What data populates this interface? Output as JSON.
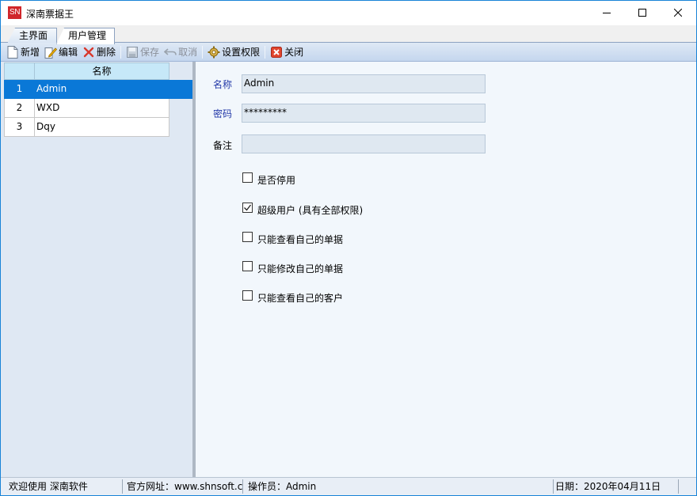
{
  "window": {
    "logo_text": "SN",
    "title": "深南票据王",
    "brand_color": "#d0262b"
  },
  "tabs": {
    "main": "主界面",
    "users": "用户管理"
  },
  "toolbar": {
    "add": "新增",
    "edit": "编辑",
    "delete": "删除",
    "save": "保存",
    "cancel": "取消",
    "permissions": "设置权限",
    "close": "关闭"
  },
  "grid": {
    "header_name": "名称",
    "rows": [
      {
        "num": "1",
        "name": "Admin",
        "selected": true
      },
      {
        "num": "2",
        "name": "WXD",
        "selected": false
      },
      {
        "num": "3",
        "name": "Dqy",
        "selected": false
      }
    ]
  },
  "form": {
    "name_label": "名称",
    "name_value": "Admin",
    "password_label": "密码",
    "password_value": "*********",
    "note_label": "备注",
    "note_value": "",
    "checkboxes": [
      {
        "label": "是否停用",
        "checked": false
      },
      {
        "label": "超级用户 (具有全部权限)",
        "checked": true
      },
      {
        "label": "只能查看自己的单据",
        "checked": false
      },
      {
        "label": "只能修改自己的单据",
        "checked": false
      },
      {
        "label": "只能查看自己的客户",
        "checked": false
      }
    ]
  },
  "status": {
    "welcome": "欢迎使用 深南软件",
    "website": "官方网址：www.shnsoft.com",
    "operator": "操作员：Admin",
    "date": "日期：2020年04月11日"
  }
}
